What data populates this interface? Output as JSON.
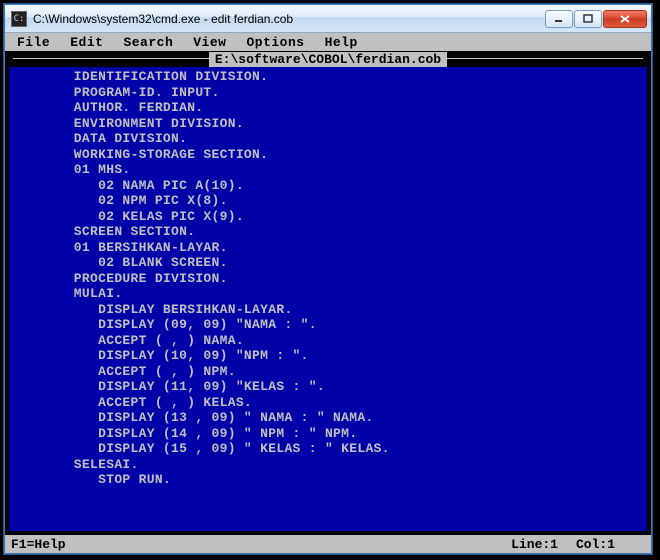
{
  "window": {
    "title": "C:\\Windows\\system32\\cmd.exe - edit  ferdian.cob"
  },
  "menubar": {
    "items": [
      "File",
      "Edit",
      "Search",
      "View",
      "Options",
      "Help"
    ]
  },
  "open_file": "E:\\software\\COBOL\\ferdian.cob",
  "code_lines": [
    "        IDENTIFICATION DIVISION.",
    "        PROGRAM-ID. INPUT.",
    "        AUTHOR. FERDIAN.",
    "        ENVIRONMENT DIVISION.",
    "        DATA DIVISION.",
    "        WORKING-STORAGE SECTION.",
    "        01 MHS.",
    "           02 NAMA PIC A(10).",
    "           02 NPM PIC X(8).",
    "           02 KELAS PIC X(9).",
    "        SCREEN SECTION.",
    "        01 BERSIHKAN-LAYAR.",
    "           02 BLANK SCREEN.",
    "        PROCEDURE DIVISION.",
    "        MULAI.",
    "           DISPLAY BERSIHKAN-LAYAR.",
    "           DISPLAY (09, 09) \"NAMA : \".",
    "           ACCEPT ( , ) NAMA.",
    "           DISPLAY (10, 09) \"NPM : \".",
    "           ACCEPT ( , ) NPM.",
    "           DISPLAY (11, 09) \"KELAS : \".",
    "           ACCEPT ( , ) KELAS.",
    "           DISPLAY (13 , 09) \" NAMA : \" NAMA.",
    "           DISPLAY (14 , 09) \" NPM : \" NPM.",
    "           DISPLAY (15 , 09) \" KELAS : \" KELAS.",
    "        SELESAI.",
    "           STOP RUN."
  ],
  "statusbar": {
    "help": "F1=Help",
    "line_label": "Line:1",
    "col_label": "Col:1"
  }
}
